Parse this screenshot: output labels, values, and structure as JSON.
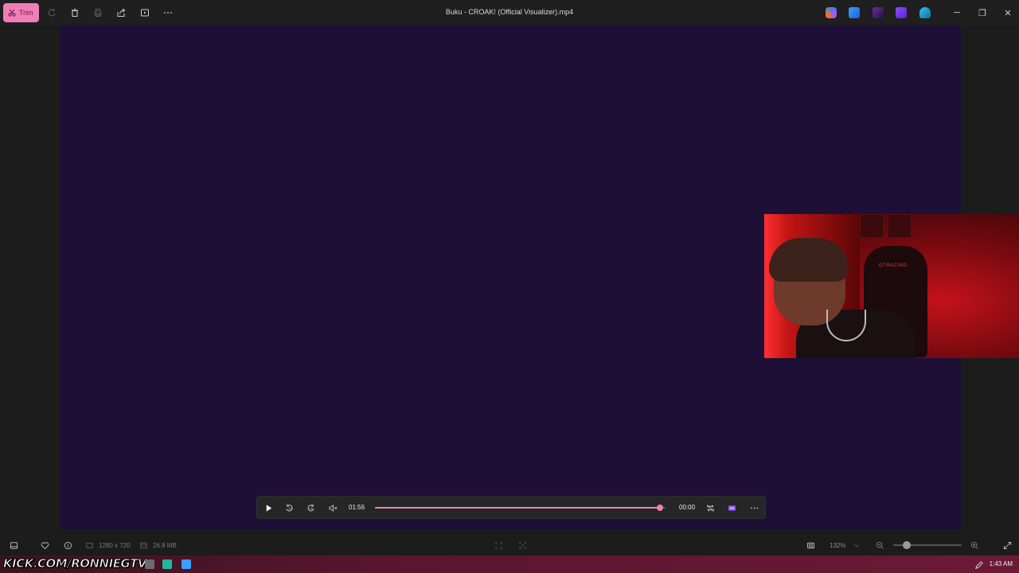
{
  "toolbar": {
    "trim_label": "Trim",
    "title": "Buku - CROAK! (Official Visualizer).mp4",
    "icons": [
      "rotate-icon",
      "delete-icon",
      "print-icon",
      "share-icon",
      "slideshow-icon",
      "more-icon"
    ]
  },
  "header_apps": [
    "copilot-icon",
    "edit-app-icon",
    "clipchamp-icon",
    "video-editor-icon",
    "onedrive-icon"
  ],
  "window_controls": {
    "minimize": "─",
    "restore": "❐",
    "close": "✕"
  },
  "player": {
    "elapsed": "01:56",
    "remaining": "00:00",
    "progress_fraction": 0.98,
    "colors": {
      "accent": "#f07fb8"
    }
  },
  "status": {
    "resolution": "1280 x 720",
    "file_size": "26.8 MB",
    "zoom_level": "132%",
    "zoom_fraction": 0.2
  },
  "webcam": {
    "chair_text": "GTRACING"
  },
  "taskbar": {
    "overlay_text": "KICK.COM/RONNIEGTV",
    "clock": "1:43 AM"
  },
  "colors": {
    "canvas_bg": "#1e0f37",
    "accent_pink": "#f07fb8"
  }
}
